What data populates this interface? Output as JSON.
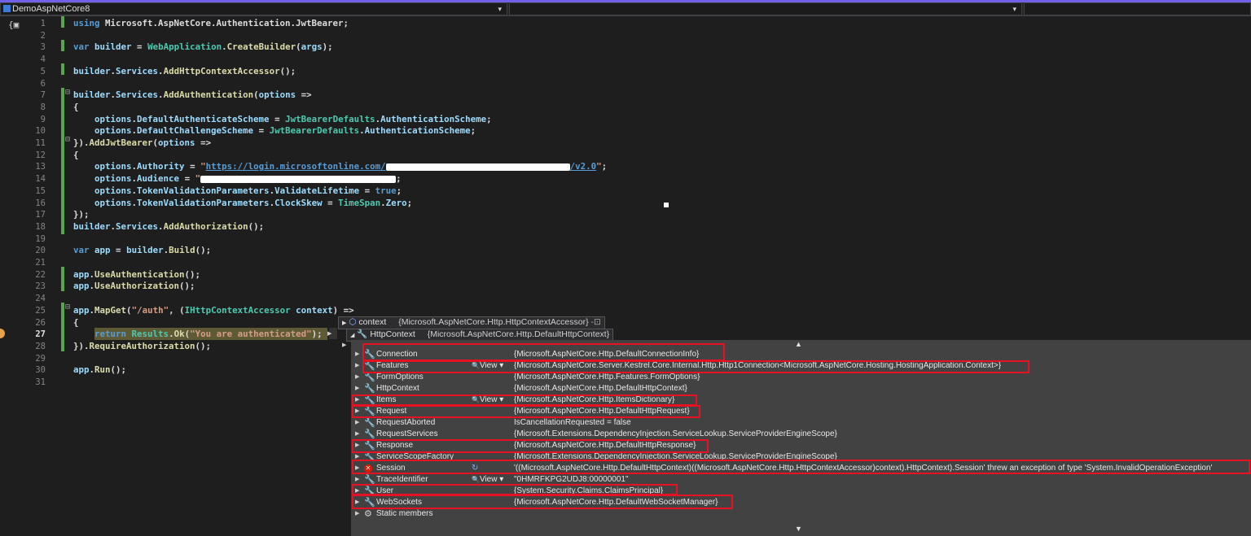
{
  "navbar": {
    "project": "DemoAspNetCore8",
    "chevron": "▾"
  },
  "code": {
    "lines": [
      {
        "n": "1",
        "html": "<span class='kw'>using</span> Microsoft.AspNetCore.Authentication.JwtBearer;"
      },
      {
        "n": "2",
        "html": ""
      },
      {
        "n": "3",
        "html": "<span class='kw'>var</span> <span class='pr'>builder</span> = <span class='ty'>WebApplication</span>.<span class='me'>CreateBuilder</span>(<span class='pr'>args</span>);"
      },
      {
        "n": "4",
        "html": ""
      },
      {
        "n": "5",
        "html": "<span class='pr'>builder</span>.<span class='pr'>Services</span>.<span class='me'>AddHttpContextAccessor</span>();"
      },
      {
        "n": "6",
        "html": ""
      },
      {
        "n": "7",
        "html": "<span class='pr'>builder</span>.<span class='pr'>Services</span>.<span class='me'>AddAuthentication</span>(<span class='pr'>options</span> =>"
      },
      {
        "n": "8",
        "html": "{"
      },
      {
        "n": "9",
        "html": "    <span class='pr'>options</span>.<span class='pr'>DefaultAuthenticateScheme</span> = <span class='ty'>JwtBearerDefaults</span>.<span class='pr'>AuthenticationScheme</span>;"
      },
      {
        "n": "10",
        "html": "    <span class='pr'>options</span>.<span class='pr'>DefaultChallengeScheme</span> = <span class='ty'>JwtBearerDefaults</span>.<span class='pr'>AuthenticationScheme</span>;"
      },
      {
        "n": "11",
        "html": "}).<span class='me'>AddJwtBearer</span>(<span class='pr'>options</span> =>"
      },
      {
        "n": "12",
        "html": "{"
      },
      {
        "n": "13",
        "html": "    <span class='pr'>options</span>.<span class='pr'>Authority</span> = <span class='st'>\"</span><span class='url'>https://login.microsoftonline.com/</span><span class='redact' style='width:226px'></span><span class='url'>/v2.0</span><span class='st'>\"</span>;"
      },
      {
        "n": "14",
        "html": "    <span class='pr'>options</span>.<span class='pr'>Audience</span> = <span class='st'>\"</span><span class='redact' style='width:240px'></span>;"
      },
      {
        "n": "15",
        "html": "    <span class='pr'>options</span>.<span class='pr'>TokenValidationParameters</span>.<span class='pr'>ValidateLifetime</span> = <span class='kw'>true</span>;"
      },
      {
        "n": "16",
        "html": "    <span class='pr'>options</span>.<span class='pr'>TokenValidationParameters</span>.<span class='pr'>ClockSkew</span> = <span class='ty'>TimeSpan</span>.<span class='pr'>Zero</span>;"
      },
      {
        "n": "17",
        "html": "});"
      },
      {
        "n": "18",
        "html": "<span class='pr'>builder</span>.<span class='pr'>Services</span>.<span class='me'>AddAuthorization</span>();"
      },
      {
        "n": "19",
        "html": ""
      },
      {
        "n": "20",
        "html": "<span class='kw'>var</span> <span class='pr'>app</span> = <span class='pr'>builder</span>.<span class='me'>Build</span>();"
      },
      {
        "n": "21",
        "html": ""
      },
      {
        "n": "22",
        "html": "<span class='pr'>app</span>.<span class='me'>UseAuthentication</span>();"
      },
      {
        "n": "23",
        "html": "<span class='pr'>app</span>.<span class='me'>UseAuthorization</span>();"
      },
      {
        "n": "24",
        "html": ""
      },
      {
        "n": "25",
        "html": "<span class='pr'>app</span>.<span class='me'>MapGet</span>(<span class='st'>\"/auth\"</span>, (<span class='ty'>IHttpContextAccessor</span> <span class='pr'>context</span>) =>"
      },
      {
        "n": "26",
        "html": "{"
      },
      {
        "n": "27",
        "html": "    <span class='kw'>return</span> <span class='ty'>Results</span>.<span class='me'>Ok</span>(<span class='st'>\"You are authenticated\"</span>);"
      },
      {
        "n": "28",
        "html": "}).<span class='me'>RequireAuthorization</span>();"
      },
      {
        "n": "29",
        "html": ""
      },
      {
        "n": "30",
        "html": "<span class='pr'>app</span>.<span class='me'>Run</span>();"
      },
      {
        "n": "31",
        "html": ""
      }
    ],
    "current_line": "27"
  },
  "datatip": {
    "context_name": "context",
    "context_value": "{Microsoft.AspNetCore.Http.HttpContextAccessor}",
    "httpcontext_name": "HttpContext",
    "httpcontext_value": "{Microsoft.AspNetCore.Http.DefaultHttpContext}",
    "view_label": "View",
    "rows": [
      {
        "name": "Connection",
        "value": "{Microsoft.AspNetCore.Http.DefaultConnectionInfo}",
        "icon": "wrench-icon",
        "view": false,
        "err": false
      },
      {
        "name": "Features",
        "value": "{Microsoft.AspNetCore.Server.Kestrel.Core.Internal.Http.Http1Connection<Microsoft.AspNetCore.Hosting.HostingApplication.Context>}",
        "icon": "wrench-icon",
        "view": true,
        "err": false
      },
      {
        "name": "FormOptions",
        "value": "{Microsoft.AspNetCore.Http.Features.FormOptions}",
        "icon": "wrench-icon",
        "view": false,
        "err": false
      },
      {
        "name": "HttpContext",
        "value": "{Microsoft.AspNetCore.Http.DefaultHttpContext}",
        "icon": "wrench-icon",
        "view": false,
        "err": false
      },
      {
        "name": "Items",
        "value": "{Microsoft.AspNetCore.Http.ItemsDictionary}",
        "icon": "wrench-icon",
        "view": true,
        "err": false
      },
      {
        "name": "Request",
        "value": "{Microsoft.AspNetCore.Http.DefaultHttpRequest}",
        "icon": "wrench-icon",
        "view": false,
        "err": false
      },
      {
        "name": "RequestAborted",
        "value": "IsCancellationRequested = false",
        "icon": "wrench-icon",
        "view": false,
        "err": false
      },
      {
        "name": "RequestServices",
        "value": "{Microsoft.Extensions.DependencyInjection.ServiceLookup.ServiceProviderEngineScope}",
        "icon": "wrench-icon",
        "view": false,
        "err": false
      },
      {
        "name": "Response",
        "value": "{Microsoft.AspNetCore.Http.DefaultHttpResponse}",
        "icon": "wrench-icon",
        "view": false,
        "err": false
      },
      {
        "name": "ServiceScopeFactory",
        "value": "{Microsoft.Extensions.DependencyInjection.ServiceLookup.ServiceProviderEngineScope}",
        "icon": "wrench-icon",
        "view": false,
        "err": false
      },
      {
        "name": "Session",
        "value": "'((Microsoft.AspNetCore.Http.DefaultHttpContext)((Microsoft.AspNetCore.Http.HttpContextAccessor)context).HttpContext).Session' threw an exception of type 'System.InvalidOperationException'",
        "icon": "error-icon",
        "view": false,
        "err": true
      },
      {
        "name": "TraceIdentifier",
        "value": "\"0HMRFKPG2UDJ8:00000001\"",
        "icon": "wrench-icon",
        "view": true,
        "err": false
      },
      {
        "name": "User",
        "value": "{System.Security.Claims.ClaimsPrincipal}",
        "icon": "wrench-icon",
        "view": false,
        "err": false
      },
      {
        "name": "WebSockets",
        "value": "{Microsoft.AspNetCore.Http.DefaultWebSocketManager}",
        "icon": "wrench-icon",
        "view": false,
        "err": false
      },
      {
        "name": "Static members",
        "value": "",
        "icon": "static-members-icon",
        "view": false,
        "err": false
      }
    ]
  },
  "colors": {
    "highlight": "#e81123",
    "accent": "#7160e8",
    "changed": "#57a64a"
  }
}
